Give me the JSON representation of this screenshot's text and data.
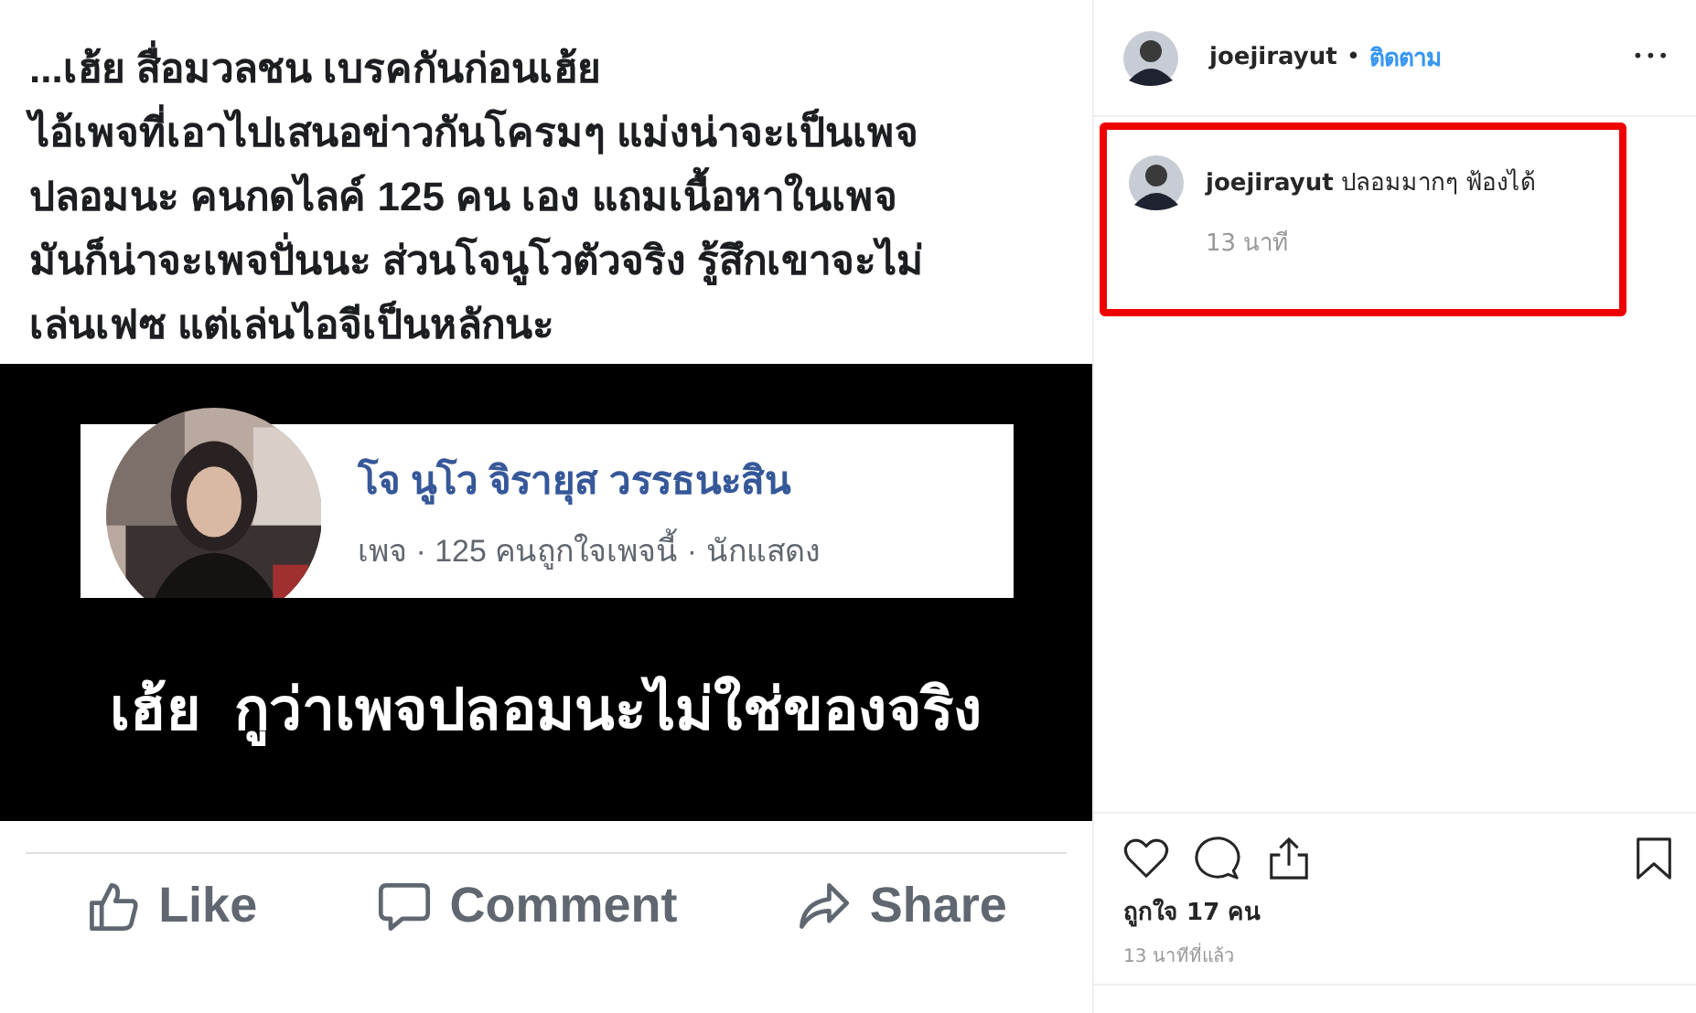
{
  "post_image": {
    "caption": "...เฮ้ย สื่อมวลชน เบรคกันก่อนเฮ้ย\nไอ้เพจที่เอาไปเสนอข่าวกันโครมๆ แม่งน่าจะเป็นเพจ\nปลอมนะ คนกดไลค์ 125 คน เอง แถมเนื้อหาในเพจ\nมันก็น่าจะเพจปั่นนะ ส่วนโจนูโวตัวจริง รู้สึกเขาจะไม่\nเล่นเฟซ แต่เล่นไอจีเป็นหลักนะ",
    "page_card": {
      "name": "โจ นูโว จิรายุส วรรธนะสิน",
      "details": "เพจ · 125 คนถูกใจเพจนี้ · นักแสดง"
    },
    "banner": "เฮ้ย  กูว่าเพจปลอมนะไม่ใช่ของจริง",
    "actions": [
      {
        "kind": "like",
        "label": "Like"
      },
      {
        "kind": "comment",
        "label": "Comment"
      },
      {
        "kind": "share",
        "label": "Share"
      }
    ]
  },
  "header": {
    "username": "joejirayut",
    "separator": "•",
    "follow": "ติดตาม",
    "more": "•••"
  },
  "comments": [
    {
      "username": "joejirayut",
      "text": "ปลอมมากๆ ฟ้องได้",
      "time": "13 นาที",
      "highlighted": true
    }
  ],
  "likes": "ถูกใจ 17 คน",
  "posted": "13 นาทีที่แล้ว"
}
